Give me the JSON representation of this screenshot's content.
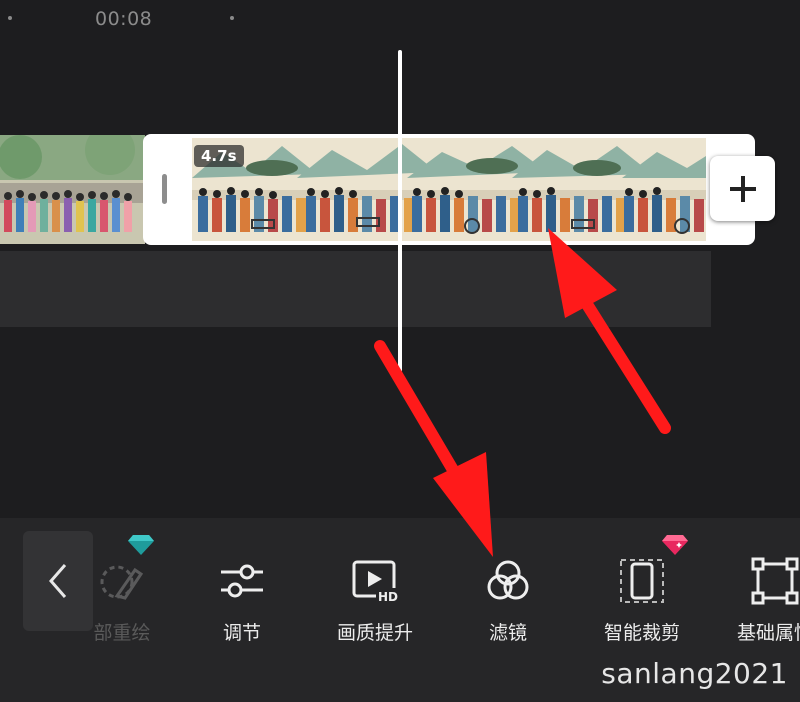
{
  "timeline": {
    "current_time": "00:08",
    "clip": {
      "duration": "4.7s"
    }
  },
  "toolbar": {
    "tools": [
      {
        "label": "部重绘",
        "icon": "repaint-brush-icon",
        "badge": "diamond-badge-icon",
        "state": "disabled"
      },
      {
        "label": "调节",
        "icon": "sliders-icon"
      },
      {
        "label": "画质提升",
        "icon": "hd-quality-icon"
      },
      {
        "label": "滤镜",
        "icon": "filter-circles-icon"
      },
      {
        "label": "智能裁剪",
        "icon": "smart-crop-icon",
        "badge": "pink-diamond-badge-icon"
      },
      {
        "label": "基础属性",
        "icon": "transform-box-icon"
      }
    ]
  },
  "watermark": "sanlang2021",
  "colors": {
    "background": "#1d1d1f",
    "toolbar": "#262628",
    "accent_arrow": "#ff1a1a",
    "badge_teal": "#29b5b5",
    "badge_pink": "#ff3d7f"
  }
}
